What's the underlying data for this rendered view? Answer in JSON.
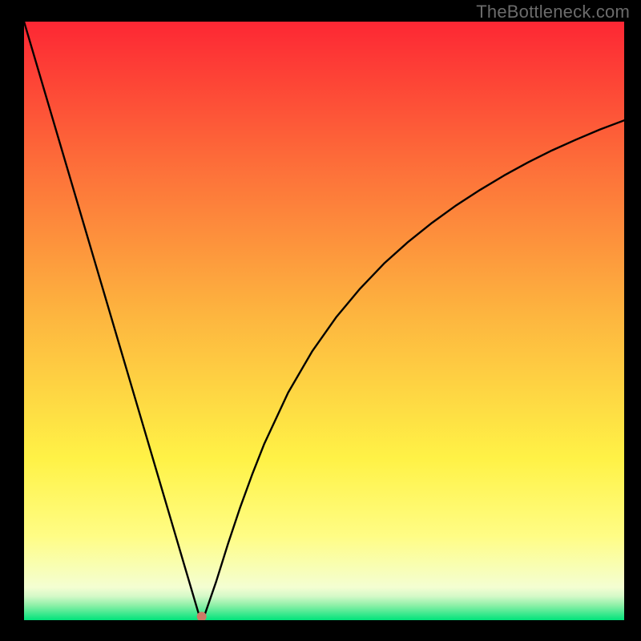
{
  "watermark": "TheBottleneck.com",
  "colors": {
    "frame_bg": "#000000",
    "watermark": "#6b6b6b",
    "curve": "#000000",
    "dot": "#cc7a66",
    "gradient_top": "#fd2734",
    "gradient_red_orange": "#fd773a",
    "gradient_orange": "#fdb53f",
    "gradient_yellow": "#fff246",
    "gradient_light_yellow": "#fffd85",
    "gradient_pale": "#f4fed2",
    "gradient_green": "#00e37b"
  },
  "chart_data": {
    "type": "line",
    "title": "",
    "xlabel": "",
    "ylabel": "",
    "xlim": [
      0,
      100
    ],
    "ylim": [
      0,
      100
    ],
    "x": [
      0,
      2,
      4,
      6,
      8,
      10,
      12,
      14,
      16,
      18,
      20,
      22,
      24,
      25,
      26,
      27,
      27.5,
      28,
      28.5,
      29,
      29.3,
      29.6,
      30,
      32,
      34,
      36,
      38,
      40,
      44,
      48,
      52,
      56,
      60,
      64,
      68,
      72,
      76,
      80,
      84,
      88,
      92,
      96,
      100
    ],
    "values": [
      100,
      93.2,
      86.4,
      79.6,
      72.8,
      66.0,
      59.2,
      52.4,
      45.6,
      38.8,
      32.0,
      25.2,
      18.4,
      15.0,
      11.6,
      8.2,
      6.5,
      4.8,
      3.1,
      1.4,
      0.6,
      0.2,
      0.6,
      6.4,
      12.8,
      18.8,
      24.3,
      29.4,
      38.0,
      44.9,
      50.6,
      55.4,
      59.6,
      63.2,
      66.4,
      69.3,
      71.9,
      74.3,
      76.5,
      78.5,
      80.3,
      82.0,
      83.5
    ],
    "annotations": [
      {
        "type": "dot",
        "x": 29.6,
        "y": 0.6
      }
    ],
    "gradient_stops_y": {
      "0.00": "#fd2734",
      "0.27": "#fd773a",
      "0.49": "#fdb53f",
      "0.73": "#fff246",
      "0.86": "#fffd85",
      "0.945": "#f4fed2",
      "0.960": "#d4f9c8",
      "0.975": "#8ef0a8",
      "1.00": "#00e37b"
    }
  }
}
